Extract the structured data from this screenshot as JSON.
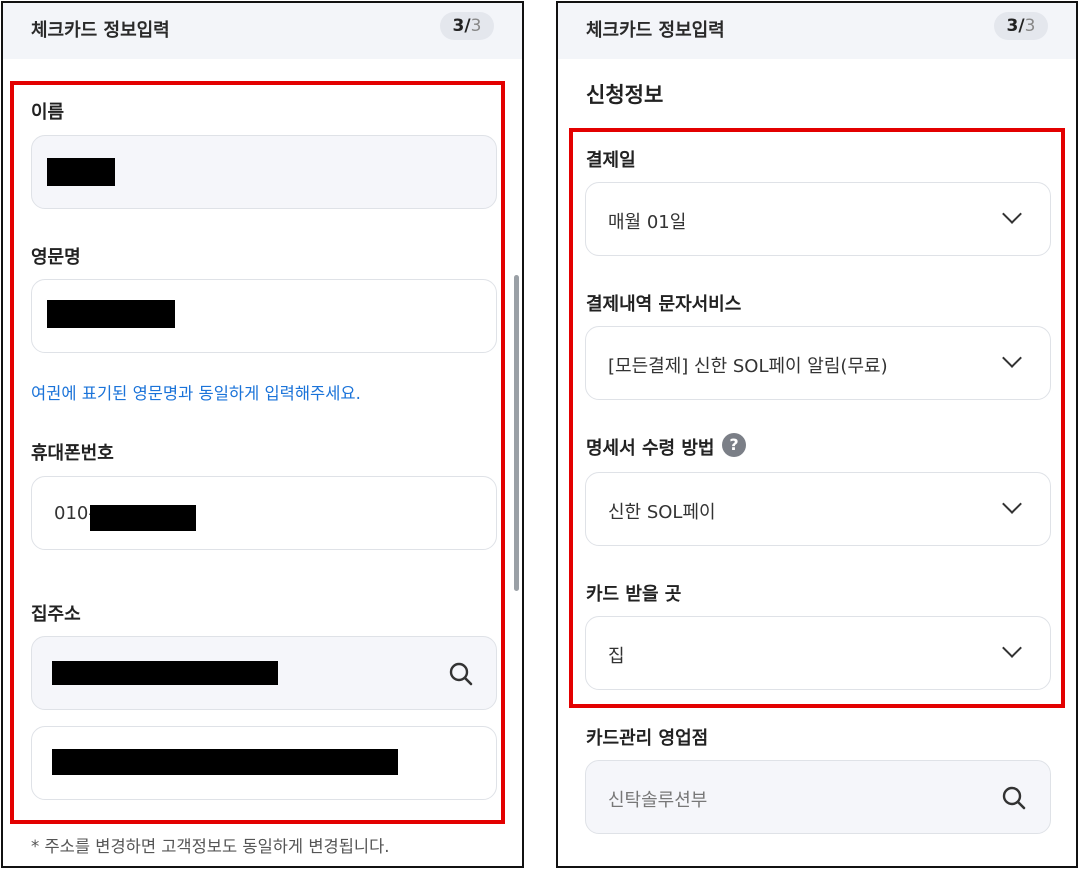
{
  "left": {
    "header": {
      "title": "체크카드 정보입력",
      "step_current": "3",
      "step_sep": "/",
      "step_total": "3"
    },
    "name": {
      "label": "이름"
    },
    "english_name": {
      "label": "영문명",
      "hint": "여권에 표기된 영문명과 동일하게 입력해주세요."
    },
    "phone": {
      "label": "휴대폰번호",
      "prefix": "010-"
    },
    "address": {
      "label": "집주소",
      "note": "* 주소를 변경하면 고객정보도 동일하게 변경됩니다."
    }
  },
  "right": {
    "header": {
      "title": "체크카드 정보입력",
      "step_current": "3",
      "step_sep": "/",
      "step_total": "3"
    },
    "section_title": "신청정보",
    "payment_day": {
      "label": "결제일",
      "value": "매월 01일"
    },
    "sms_service": {
      "label": "결제내역 문자서비스",
      "value": "[모든결제] 신한 SOL페이 알림(무료)"
    },
    "statement": {
      "label": "명세서 수령 방법",
      "help": "?",
      "value": "신한 SOL페이"
    },
    "card_delivery": {
      "label": "카드 받을 곳",
      "value": "집"
    },
    "branch": {
      "label": "카드관리 영업점",
      "placeholder": "신탁솔루션부"
    }
  },
  "colors": {
    "highlight": "#e30000",
    "hint": "#1a73d9",
    "header_bg": "#f3f5f9"
  },
  "icons": [
    "search-icon",
    "chevron-down-icon",
    "help-icon"
  ]
}
